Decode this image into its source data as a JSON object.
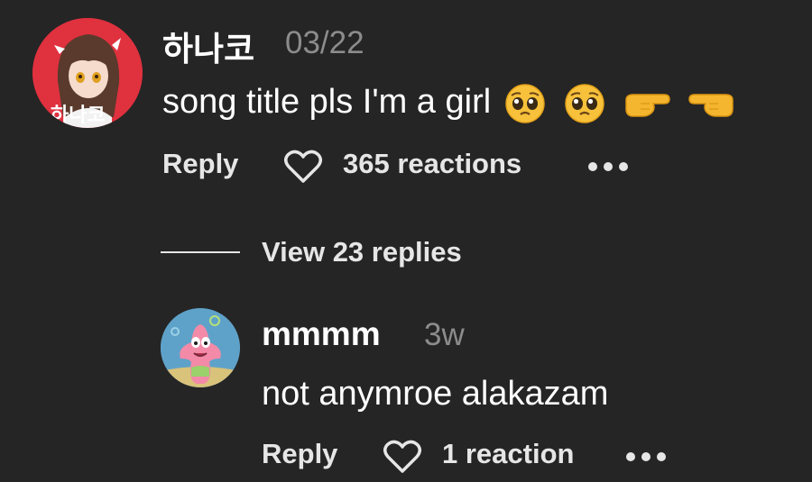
{
  "comments": [
    {
      "username": "하나코",
      "timestamp": "03/22",
      "text": "song title pls I'm a girl",
      "emojis": [
        "pleading-face",
        "pleading-face",
        "backhand-pointing-right",
        "backhand-pointing-left"
      ],
      "avatar_text": "하나코",
      "reply_label": "Reply",
      "reactions_label": "365 reactions"
    },
    {
      "username": "mmmm",
      "timestamp": "3w",
      "text": "not anymroe alakazam",
      "reply_label": "Reply",
      "reactions_label": "1 reaction"
    }
  ],
  "view_replies_label": "View 23 replies",
  "colors": {
    "background": "#252525",
    "text": "#ffffff",
    "muted": "#8c8c8c",
    "action": "#e6e6e6",
    "avatar1_bg": "#e0313f",
    "avatar2_bg": "#5fa2c9"
  },
  "icons": {
    "heart": "heart-outline-icon",
    "more": "more-dots-icon"
  }
}
